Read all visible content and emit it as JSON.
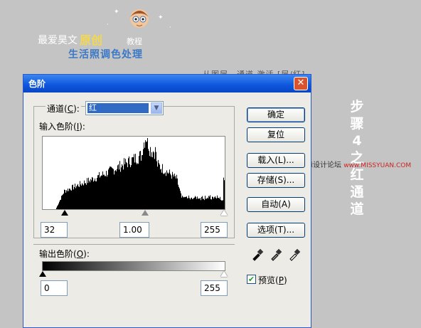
{
  "header": {
    "brand_prefix": "最爱昊文",
    "brand_accent": "原创",
    "brand_suffix": "教程",
    "subtitle": "生活照调色处理",
    "partial_text": "从图层—通道 激活 [层/红]"
  },
  "side_text": [
    "步",
    "骤",
    "4",
    "之",
    "红",
    "通",
    "道"
  ],
  "watermark": {
    "text": "思缘设计论坛",
    "url": "www.MISSYUAN.COM"
  },
  "dialog": {
    "title": "色阶",
    "close_glyph": "✕",
    "channel_label": "通道(",
    "channel_key": "C",
    "channel_label_end": "):",
    "channel_value": "红",
    "input_label": "输入色阶(",
    "input_key": "I",
    "input_label_end": "):",
    "input_black": "32",
    "input_gamma": "1.00",
    "input_white": "255",
    "output_label": "输出色阶(",
    "output_key": "O",
    "output_label_end": "):",
    "output_black": "0",
    "output_white": "255",
    "buttons": {
      "ok": "确定",
      "reset": "复位",
      "load": "载入(L)...",
      "save": "存储(S)...",
      "auto": "自动(A)",
      "options": "选项(T)..."
    },
    "preview_label": "预览(",
    "preview_key": "P",
    "preview_label_end": ")",
    "preview_checked": true
  },
  "colors": {
    "titlebar": "#0d55dd",
    "dialog_bg": "#ecebe5",
    "subtitle": "#3c78c6",
    "accent": "#f2d94e",
    "watermark_url": "#cc2222"
  }
}
